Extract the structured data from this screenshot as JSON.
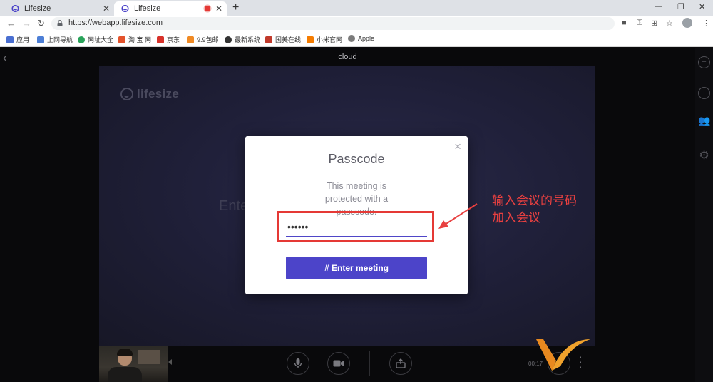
{
  "browser": {
    "tabs": [
      {
        "title": "Lifesize",
        "active": false
      },
      {
        "title": "Lifesize",
        "active": true,
        "recording": true
      }
    ],
    "url": "https://webapp.lifesize.com",
    "bookmarks": [
      {
        "label": "应用",
        "color": "#4a6fd1"
      },
      {
        "label": "上网导航",
        "color": "#4d7fd6"
      },
      {
        "label": "网址大全",
        "color": "#2aa35a"
      },
      {
        "label": "淘 宝 网",
        "color": "#e4532c"
      },
      {
        "label": "京东",
        "color": "#d8322a"
      },
      {
        "label": "9.9包邮",
        "color": "#f08a24"
      },
      {
        "label": "最新系统",
        "color": "#333333"
      },
      {
        "label": "国美在线",
        "color": "#c0392b"
      },
      {
        "label": "小米官网",
        "color": "#f57c00"
      },
      {
        "label": "Apple",
        "color": "#7b7b7b"
      }
    ]
  },
  "app": {
    "header_label": "cloud",
    "brand": "lifesize",
    "background_prompt": "Ente",
    "timer": "00:17"
  },
  "modal": {
    "title": "Passcode",
    "message": "This meeting is protected with a passcode.",
    "passcode_value": "••••••",
    "enter_button": "# Enter meeting",
    "close_icon": "×"
  },
  "annotation": {
    "line1": "输入会议的号码",
    "line2": "加入会议",
    "color": "#e84040"
  },
  "colors": {
    "accent": "#4c44c9",
    "highlight": "#e53935"
  }
}
